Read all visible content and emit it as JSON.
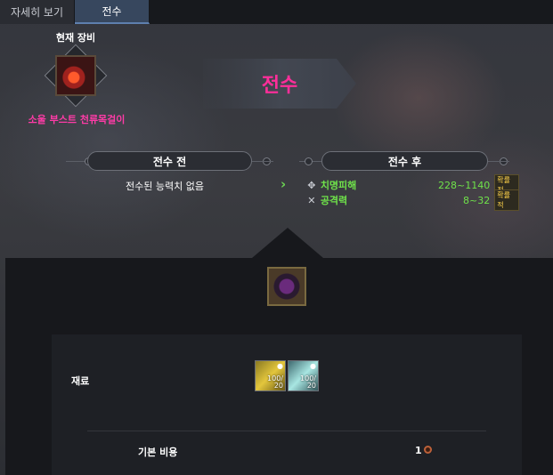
{
  "tabs": [
    {
      "label": "자세히 보기",
      "active": false
    },
    {
      "label": "전수",
      "active": true
    }
  ],
  "current_equipment": {
    "label": "현재 장비",
    "item_name": "소울 부스트 천류목걸이",
    "item_icon": "necklace-icon"
  },
  "banner": {
    "title": "전수"
  },
  "before": {
    "header": "전수 전",
    "text": "전수된 능력치 없음"
  },
  "after": {
    "header": "전수 후",
    "stats": [
      {
        "icon": "crosshair-icon",
        "name": "치명피해",
        "value": "228~1140",
        "badge": "확률적"
      },
      {
        "icon": "crossed-swords-icon",
        "name": "공격력",
        "value": "8~32",
        "badge": "확률적"
      }
    ]
  },
  "materials": {
    "label": "재료",
    "items": [
      {
        "icon": "gold-crystal-icon",
        "count": "100/\n20"
      },
      {
        "icon": "cyan-crystal-icon",
        "count": "100/\n20"
      }
    ]
  },
  "cost": {
    "label": "기본 비용",
    "value": "1",
    "icon": "coin-icon"
  },
  "colors": {
    "accent_pink": "#ff2e9a",
    "stat_green": "#6fe24a",
    "active_tab": "#37475e"
  }
}
